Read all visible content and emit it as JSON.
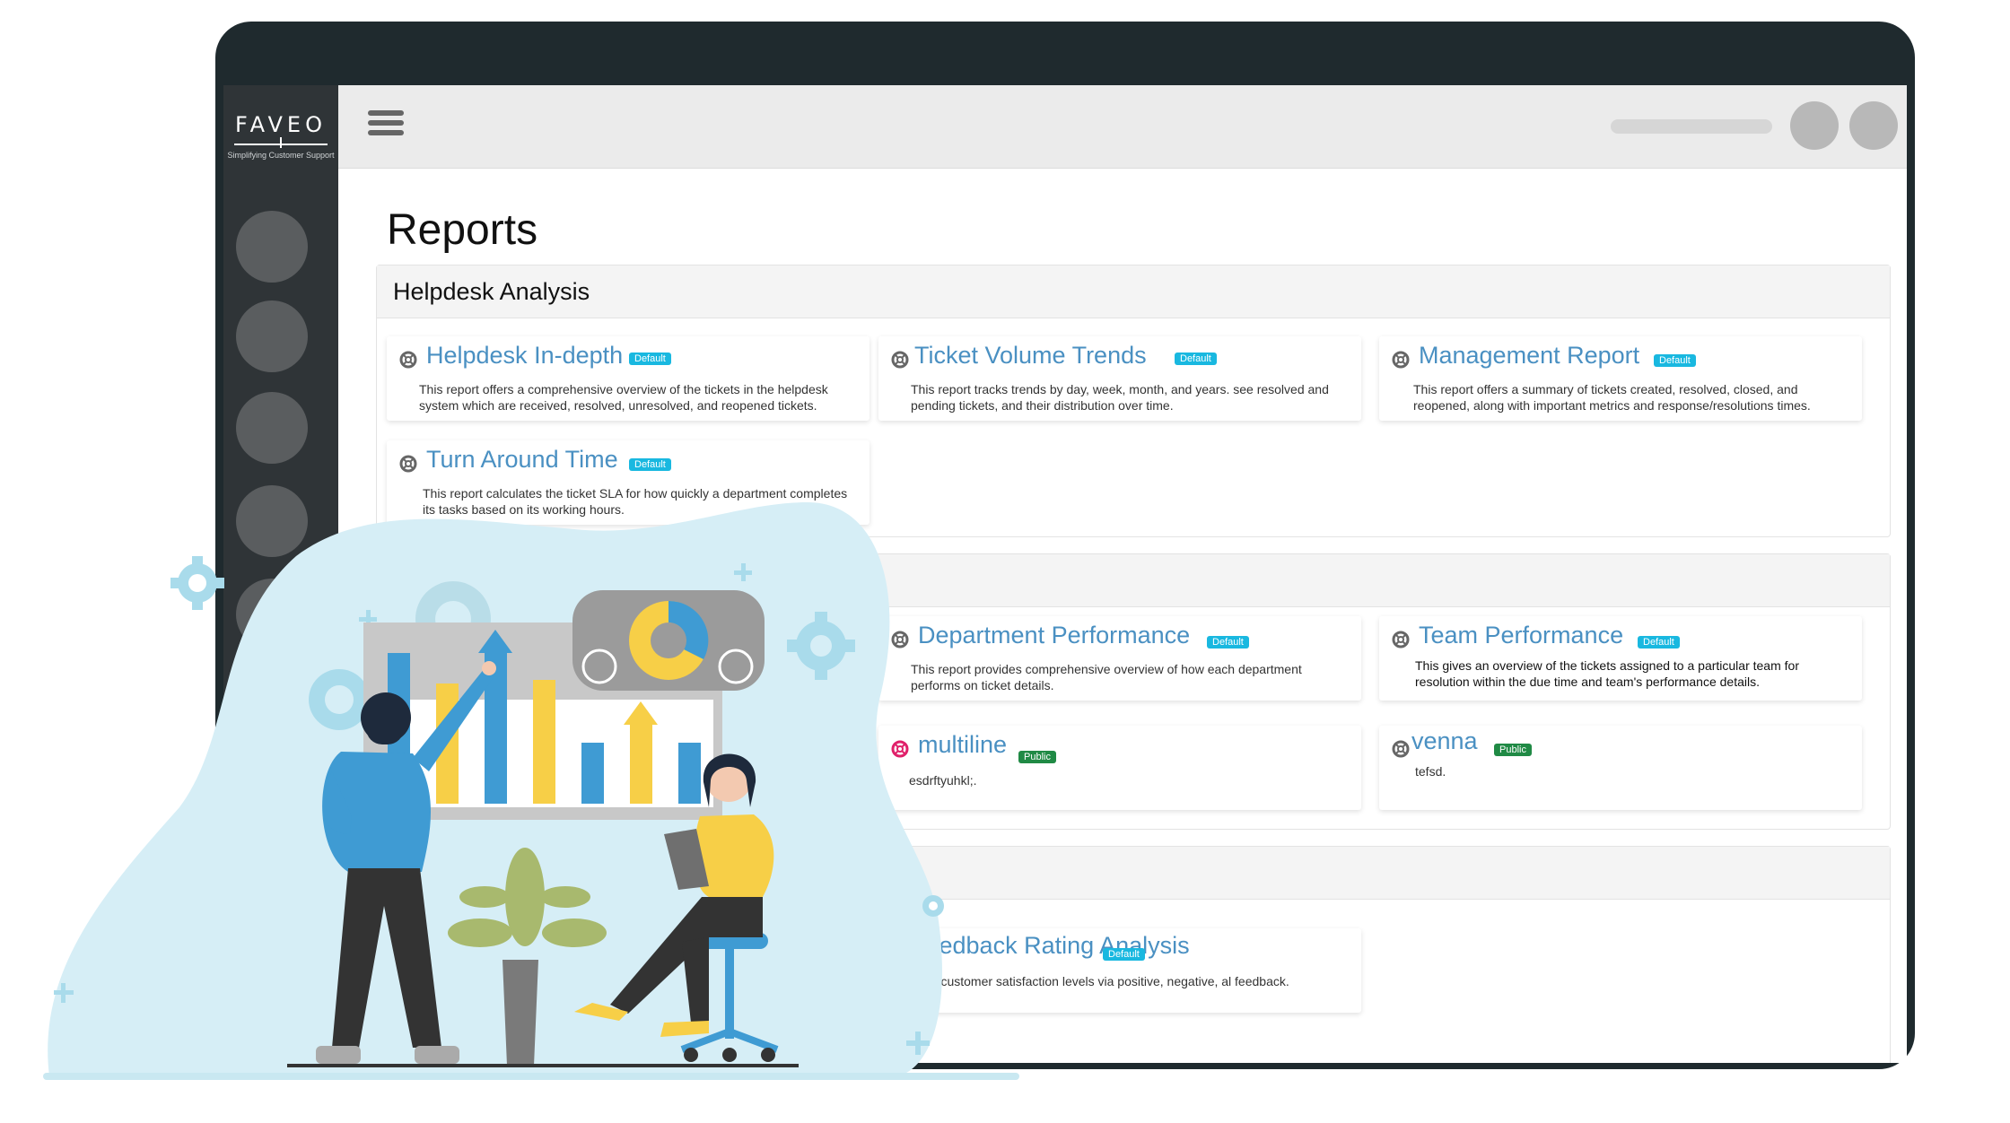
{
  "brand": {
    "logo": "FAVEO",
    "tagline": "Simplifying Customer Support"
  },
  "page": {
    "title": "Reports"
  },
  "sections": [
    {
      "title": "Helpdesk Analysis"
    },
    {
      "title": ""
    },
    {
      "title": ""
    }
  ],
  "cards": [
    {
      "title": "Helpdesk In-depth",
      "badge": "Default",
      "description": "This report offers a comprehensive overview of the tickets in the helpdesk system which are received, resolved, unresolved, and reopened tickets.",
      "icon": "lifebuoy-icon"
    },
    {
      "title": "Ticket Volume Trends",
      "badge": "Default",
      "description": "This report tracks trends by day, week, month, and years. see resolved and pending tickets, and their distribution over time.",
      "icon": "lifebuoy-icon"
    },
    {
      "title": "Management Report",
      "badge": "Default",
      "description": "This report offers a summary of tickets created, resolved, closed, and reopened, along with important metrics and response/resolutions times.",
      "icon": "lifebuoy-icon"
    },
    {
      "title": "Turn Around Time",
      "badge": "Default",
      "description": "This report calculates the ticket SLA for how quickly a department completes its tasks based on its working hours.",
      "icon": "lifebuoy-icon"
    },
    {
      "title": "Department Performance",
      "badge": "Default",
      "description": "This report provides comprehensive overview of how each department performs on ticket details.",
      "icon": "lifebuoy-icon"
    },
    {
      "title": "Team Performance",
      "badge": "Default",
      "description": "This gives an overview of the tickets assigned to a particular team for resolution within the due time and team's performance details.",
      "icon": "lifebuoy-icon"
    },
    {
      "title": "multiline",
      "badge": "Public",
      "description": "esdrftyuhkl;.",
      "icon": "lifebuoy-icon"
    },
    {
      "title": "venna",
      "badge": "Public",
      "description": "tefsd.",
      "icon": "lifebuoy-icon"
    },
    {
      "title": "Feedback Rating Analysis",
      "badge": "Default",
      "description": "rizes customer satisfaction levels via positive, negative, al feedback.",
      "icon": "lifebuoy-icon"
    }
  ],
  "colors": {
    "link": "#4a90c2",
    "default_badge": "#19b8e0",
    "public_badge": "#208a45",
    "frame": "#1f2a2e",
    "sidebar": "#2f3437"
  }
}
